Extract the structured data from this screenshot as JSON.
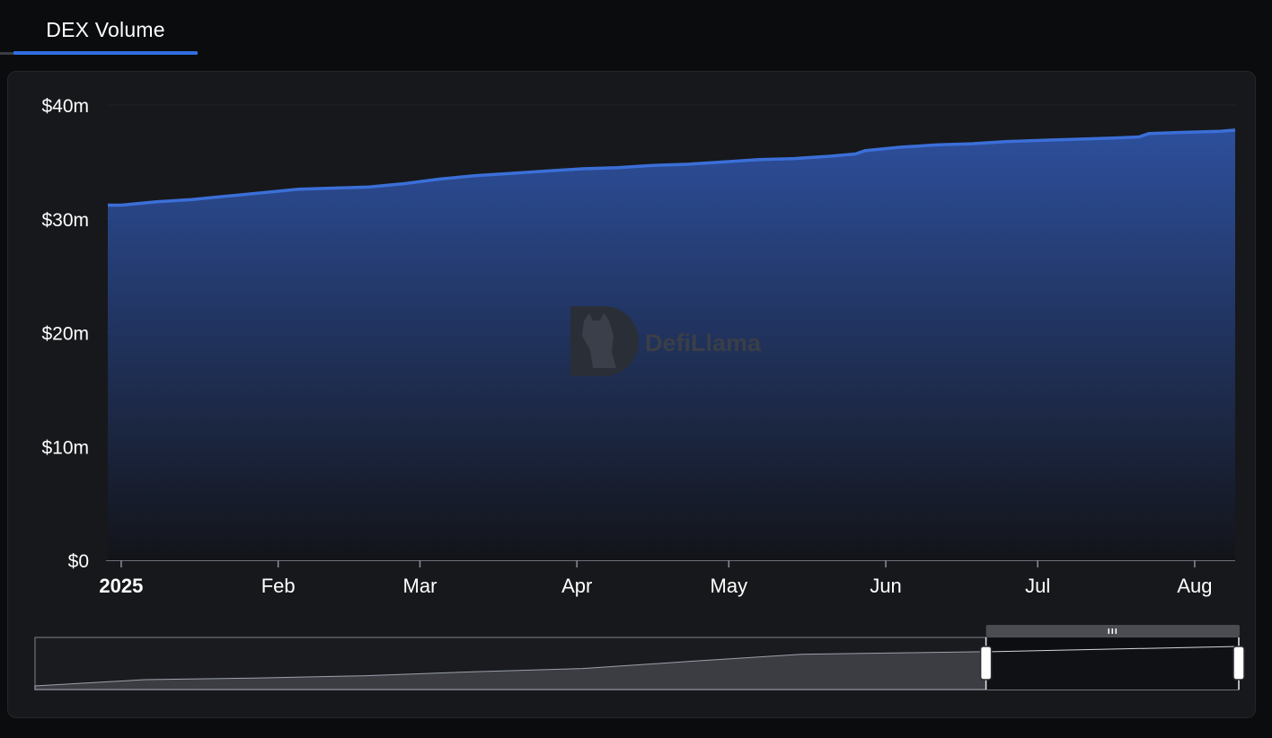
{
  "tabs": [
    {
      "label": "DEX Volume",
      "active": true
    }
  ],
  "colors": {
    "accent": "#2f6ee0",
    "line": "#3b6fd8",
    "area_top": "#2d4f9c",
    "area_bottom": "#131419",
    "tick_text": "#ffffff",
    "watermark": "#3a3e47"
  },
  "watermark": {
    "text": "DefiLlama"
  },
  "chart_data": {
    "type": "area",
    "title": "",
    "xlabel": "",
    "ylabel": "",
    "series": [
      {
        "values": [
          {
            "x": "2025-01-01",
            "y": 31.2
          },
          {
            "x": "2025-01-08",
            "y": 31.5
          },
          {
            "x": "2025-01-15",
            "y": 31.7
          },
          {
            "x": "2025-01-22",
            "y": 32.0
          },
          {
            "x": "2025-01-29",
            "y": 32.3
          },
          {
            "x": "2025-02-05",
            "y": 32.6
          },
          {
            "x": "2025-02-12",
            "y": 32.7
          },
          {
            "x": "2025-02-19",
            "y": 32.8
          },
          {
            "x": "2025-02-26",
            "y": 33.1
          },
          {
            "x": "2025-03-05",
            "y": 33.5
          },
          {
            "x": "2025-03-12",
            "y": 33.8
          },
          {
            "x": "2025-03-19",
            "y": 34.0
          },
          {
            "x": "2025-03-26",
            "y": 34.2
          },
          {
            "x": "2025-04-02",
            "y": 34.4
          },
          {
            "x": "2025-04-09",
            "y": 34.5
          },
          {
            "x": "2025-04-16",
            "y": 34.7
          },
          {
            "x": "2025-04-23",
            "y": 34.8
          },
          {
            "x": "2025-04-30",
            "y": 35.0
          },
          {
            "x": "2025-05-07",
            "y": 35.2
          },
          {
            "x": "2025-05-14",
            "y": 35.3
          },
          {
            "x": "2025-05-21",
            "y": 35.5
          },
          {
            "x": "2025-05-26",
            "y": 35.7
          },
          {
            "x": "2025-05-28",
            "y": 36.0
          },
          {
            "x": "2025-06-04",
            "y": 36.3
          },
          {
            "x": "2025-06-11",
            "y": 36.5
          },
          {
            "x": "2025-06-18",
            "y": 36.6
          },
          {
            "x": "2025-06-25",
            "y": 36.8
          },
          {
            "x": "2025-07-02",
            "y": 36.9
          },
          {
            "x": "2025-07-09",
            "y": 37.0
          },
          {
            "x": "2025-07-16",
            "y": 37.1
          },
          {
            "x": "2025-07-21",
            "y": 37.2
          },
          {
            "x": "2025-07-23",
            "y": 37.5
          },
          {
            "x": "2025-07-30",
            "y": 37.6
          },
          {
            "x": "2025-08-06",
            "y": 37.7
          },
          {
            "x": "2025-08-09",
            "y": 37.8
          }
        ]
      }
    ],
    "x_range": [
      "2024-12-29",
      "2025-08-09"
    ],
    "ylim": [
      0,
      40
    ],
    "y_ticks": [
      {
        "value": 0,
        "label": "$0"
      },
      {
        "value": 10,
        "label": "$10m"
      },
      {
        "value": 20,
        "label": "$20m"
      },
      {
        "value": 30,
        "label": "$30m"
      },
      {
        "value": 40,
        "label": "$40m"
      }
    ],
    "x_ticks": [
      {
        "date": "2025-01-01",
        "label": "2025",
        "bold": true
      },
      {
        "date": "2025-02-01",
        "label": "Feb",
        "bold": false
      },
      {
        "date": "2025-03-01",
        "label": "Mar",
        "bold": false
      },
      {
        "date": "2025-04-01",
        "label": "Apr",
        "bold": false
      },
      {
        "date": "2025-05-01",
        "label": "May",
        "bold": false
      },
      {
        "date": "2025-06-01",
        "label": "Jun",
        "bold": false
      },
      {
        "date": "2025-07-01",
        "label": "Jul",
        "bold": false
      },
      {
        "date": "2025-08-01",
        "label": "Aug",
        "bold": false
      }
    ],
    "grid": false,
    "legend": "none",
    "zoom_slider": {
      "overview": [
        0.0,
        0.2,
        0.25,
        0.32,
        0.45,
        0.55,
        0.78,
        1.0,
        1.05,
        1.1,
        1.2,
        1.25
      ],
      "selection": [
        0.79,
        1.0
      ]
    }
  }
}
